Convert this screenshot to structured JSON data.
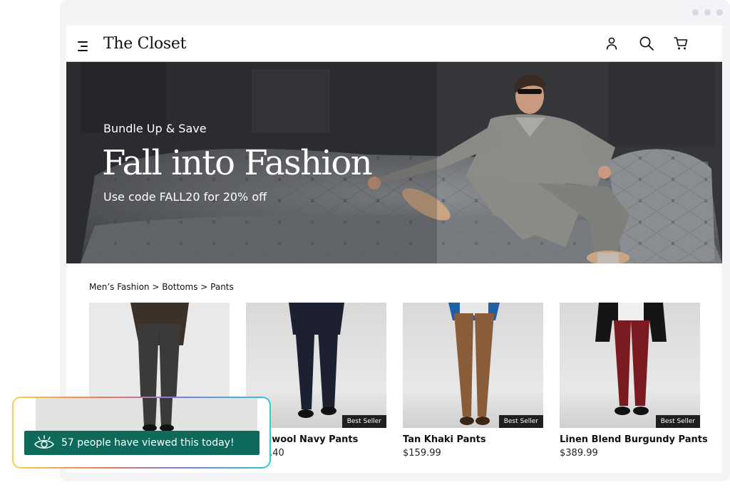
{
  "brand": "The Closet",
  "hero": {
    "subtitle": "Bundle Up & Save",
    "title": "Fall into Fashion",
    "promo": "Use code FALL20 for 20% off"
  },
  "breadcrumb": "Men’s Fashion > Bottoms > Pants",
  "products": [
    {
      "name": "",
      "price": "",
      "badge": "",
      "pants_color": "#3a3a3a",
      "jacket_color": "#3b3129"
    },
    {
      "name": "Woolwool Navy Pants",
      "price": "$189.40",
      "badge": "Best Seller",
      "pants_color": "#1c2030",
      "jacket_color": "#1c2030"
    },
    {
      "name": "Tan Khaki Pants",
      "price": "$159.99",
      "badge": "Best Seller",
      "pants_color": "#8a5d3a",
      "jacket_color": "#1f5fa8"
    },
    {
      "name": "Linen Blend Burgundy Pants",
      "price": "$389.99",
      "badge": "Best Seller",
      "pants_color": "#7a1b22",
      "jacket_color": "#151515"
    }
  ],
  "toast": {
    "text": "57 people have viewed this today!",
    "bg_color": "#0e6b5b"
  },
  "icons": [
    "menu-icon",
    "account-icon",
    "search-icon",
    "cart-icon",
    "eye-icon"
  ]
}
